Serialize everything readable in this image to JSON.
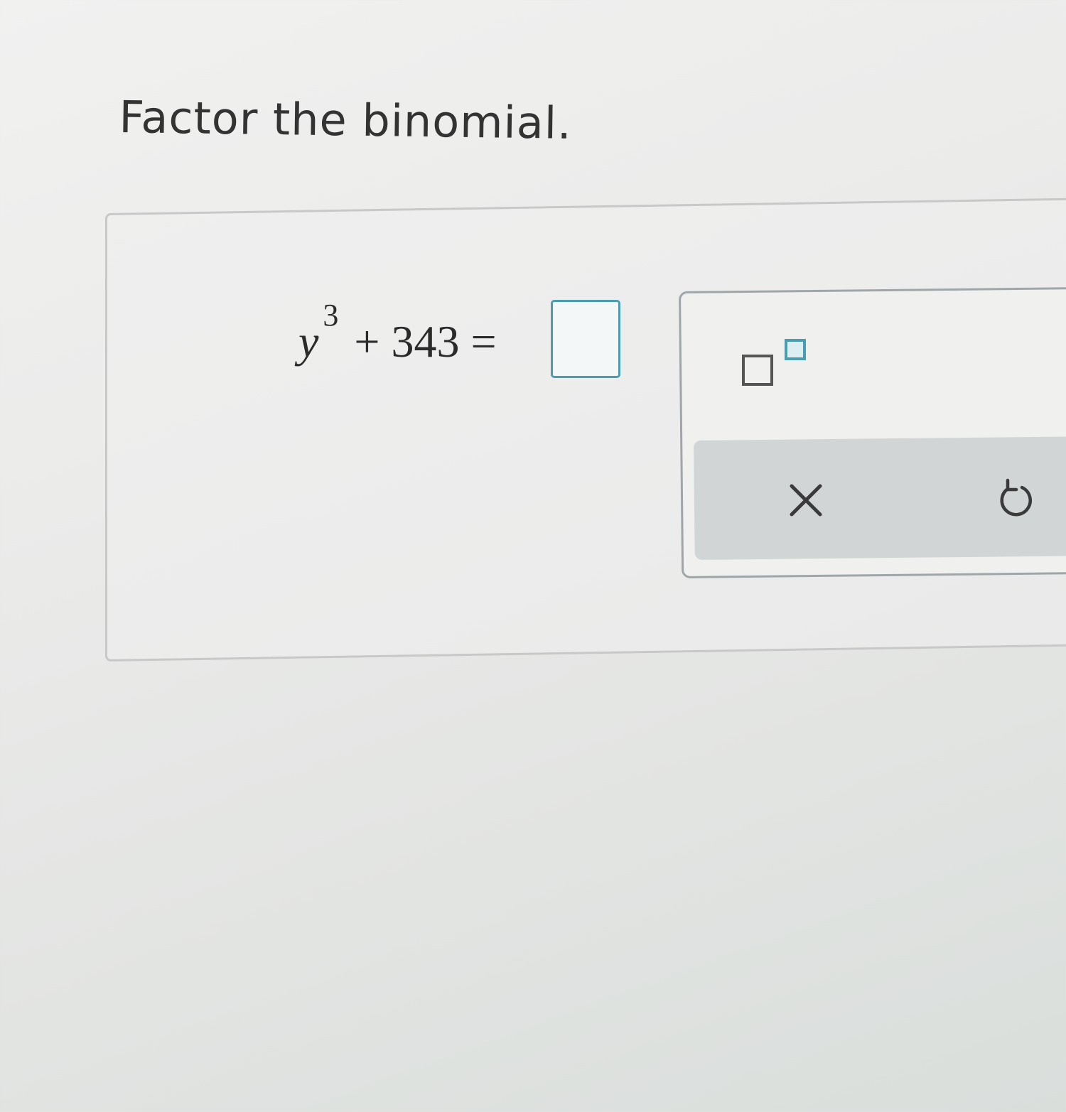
{
  "prompt": {
    "text": "Factor the binomial."
  },
  "equation": {
    "variable": "y",
    "exponent": "3",
    "rest": "+ 343 ="
  },
  "answer": {
    "value": ""
  },
  "keypad": {
    "superscript_icon": "superscript-template-icon",
    "clear_icon": "close-x-icon",
    "undo_icon": "undo-icon"
  },
  "colors": {
    "accent": "#4a9db0",
    "text": "#333333",
    "action_bar": "#d2d5d6"
  }
}
